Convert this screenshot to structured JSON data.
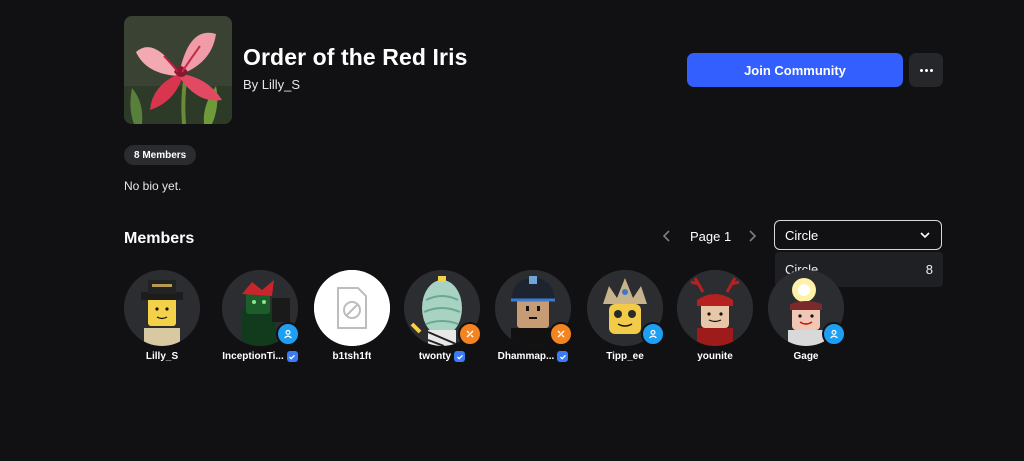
{
  "group": {
    "name": "Order of the Red Iris",
    "owner_line": "By Lilly_S",
    "members_count_label": "8 Members",
    "bio": "No bio yet.",
    "icon": "red-iris-flower-image"
  },
  "actions": {
    "join_label": "Join Community",
    "more_icon": "ellipsis-icon"
  },
  "members_section": {
    "heading": "Members",
    "page_label": "Page 1",
    "prev_icon": "chevron-left-icon",
    "next_icon": "chevron-right-icon",
    "role_filter": {
      "selected": "Circle",
      "options": [
        {
          "label": "Circle",
          "count": "8"
        }
      ]
    },
    "members": [
      {
        "name": "Lilly_S",
        "verified": false,
        "badge": null
      },
      {
        "name": "InceptionTi...",
        "verified": true,
        "badge": "friend"
      },
      {
        "name": "b1tsh1ft",
        "verified": false,
        "badge": null
      },
      {
        "name": "twonty",
        "verified": true,
        "badge": "developer"
      },
      {
        "name": "Dhammap...",
        "verified": true,
        "badge": "developer"
      },
      {
        "name": "Tipp_ee",
        "verified": false,
        "badge": "friend"
      },
      {
        "name": "younite",
        "verified": false,
        "badge": null
      },
      {
        "name": "Gage",
        "verified": false,
        "badge": "friend"
      }
    ]
  },
  "colors": {
    "background": "#111114",
    "primary_button": "#335fff",
    "verified_blue": "#3b7bf6",
    "friend_badge": "#1f9ff4",
    "developer_badge": "#f48420"
  }
}
